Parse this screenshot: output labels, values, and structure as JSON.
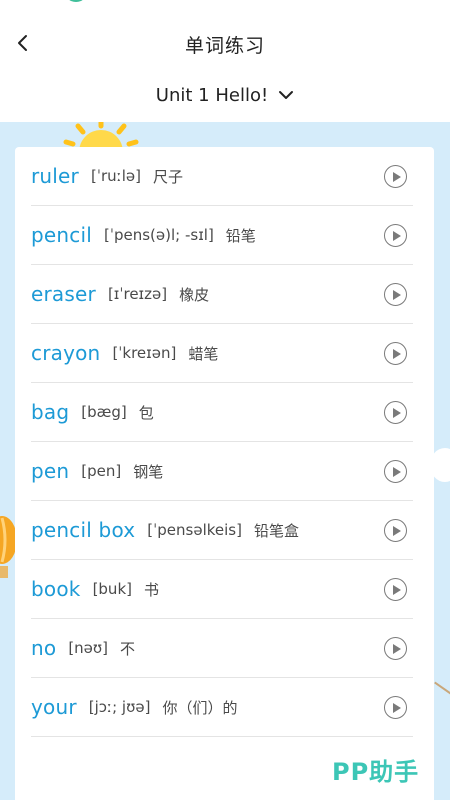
{
  "header": {
    "title": "单词练习",
    "back_icon": "chevron-left-icon"
  },
  "unit": {
    "label": "Unit 1 Hello!",
    "icon": "chevron-down-icon"
  },
  "words": [
    {
      "word": "ruler",
      "phonetic": "[ˈruːlə]",
      "meaning": "尺子"
    },
    {
      "word": "pencil",
      "phonetic": "[ˈpens(ə)l; -sɪl]",
      "meaning": "铅笔"
    },
    {
      "word": "eraser",
      "phonetic": "[ɪˈreɪzə]",
      "meaning": "橡皮"
    },
    {
      "word": "crayon",
      "phonetic": "[ˈkreɪən]",
      "meaning": "蜡笔"
    },
    {
      "word": "bag",
      "phonetic": "[bæg]",
      "meaning": "包"
    },
    {
      "word": "pen",
      "phonetic": "[pen]",
      "meaning": "钢笔"
    },
    {
      "word": "pencil box",
      "phonetic": "[ˈpensəlkeis]",
      "meaning": "铅笔盒"
    },
    {
      "word": "book",
      "phonetic": "[buk]",
      "meaning": "书"
    },
    {
      "word": "no",
      "phonetic": "[nəʊ]",
      "meaning": "不"
    },
    {
      "word": "your",
      "phonetic": "[jɔː; jʊə]",
      "meaning": "你（们）的"
    }
  ],
  "play_icon": "play-circle-icon",
  "watermark": "PP助手",
  "colors": {
    "word": "#1d9ad6",
    "background": "#d5ecfa",
    "watermark": "#3cc6b6"
  }
}
